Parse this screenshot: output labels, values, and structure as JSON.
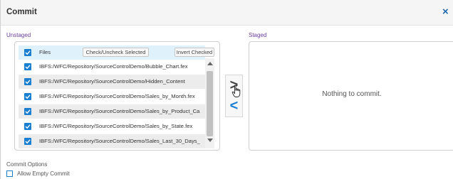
{
  "dialog": {
    "title": "Commit",
    "close_icon": "×"
  },
  "unstaged": {
    "label": "Unstaged",
    "header": {
      "checked": true,
      "files_label": "Files",
      "check_uncheck_label": "Check/Uncheck Selected",
      "invert_label": "Invert Checked"
    },
    "items": [
      {
        "path": "IBFS:/WFC/Repository/SourceControlDemo/Bubble_Chart.fex",
        "checked": true
      },
      {
        "path": "IBFS:/WFC/Repository/SourceControlDemo/Hidden_Content",
        "checked": true
      },
      {
        "path": "IBFS:/WFC/Repository/SourceControlDemo/Sales_by_Month.fex",
        "checked": true
      },
      {
        "path": "IBFS:/WFC/Repository/SourceControlDemo/Sales_by_Product_Ca",
        "checked": true
      },
      {
        "path": "IBFS:/WFC/Repository/SourceControlDemo/Sales_by_State.fex",
        "checked": true
      },
      {
        "path": "IBFS:/WFC/Repository/SourceControlDemo/Sales_Last_30_Days_",
        "checked": true
      }
    ]
  },
  "move": {
    "stage_icon": ">",
    "unstage_icon": "<"
  },
  "staged": {
    "label": "Staged",
    "empty_text": "Nothing to commit."
  },
  "options": {
    "label": "Commit Options",
    "allow_empty_label": "Allow Empty Commit",
    "allow_empty_checked": false
  },
  "colors": {
    "accent": "#1a7fd0",
    "section_label": "#6a3d9a",
    "header_row_bg": "#dff1fa",
    "alt_row_bg": "#ececec"
  }
}
